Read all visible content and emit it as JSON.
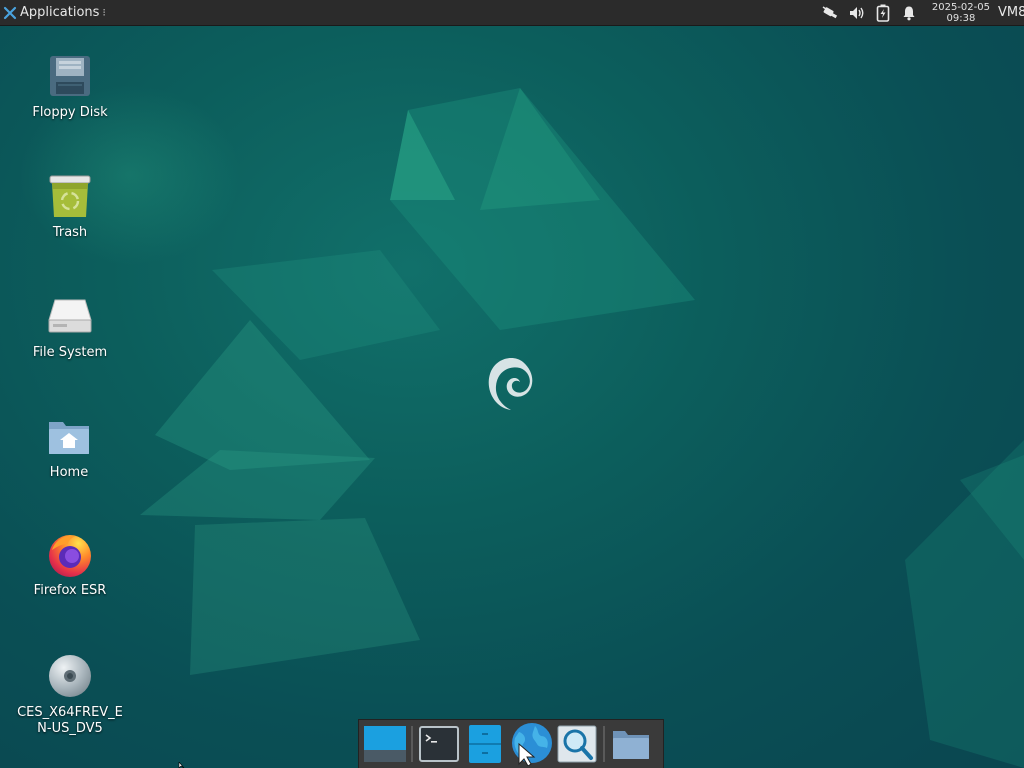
{
  "top_panel": {
    "applications_label": "Applications",
    "menu_glyph": "⁝",
    "clock_date": "2025-02-05",
    "clock_time": "09:38",
    "user_label": "VM8",
    "tray_icons": [
      "network-wired-icon",
      "volume-icon",
      "battery-icon",
      "notification-bell-icon"
    ]
  },
  "desktop_icons": [
    {
      "label": "Floppy Disk",
      "icon": "floppy-disk-icon"
    },
    {
      "label": "Trash",
      "icon": "trash-icon"
    },
    {
      "label": "File System",
      "icon": "hard-drive-icon"
    },
    {
      "label": "Home",
      "icon": "home-folder-icon"
    },
    {
      "label": "Firefox ESR",
      "icon": "firefox-icon"
    },
    {
      "label": "CES_X64FREV_EN-US_DV5",
      "icon": "optical-disc-icon"
    }
  ],
  "dock": {
    "items": [
      "show-desktop-icon",
      "terminal-icon",
      "file-manager-icon",
      "web-browser-icon",
      "app-finder-icon",
      "folder-icon"
    ]
  },
  "colors": {
    "panel": "#2b2b2b",
    "desktop": "#0c5e5c",
    "accent": "#1793d1"
  }
}
